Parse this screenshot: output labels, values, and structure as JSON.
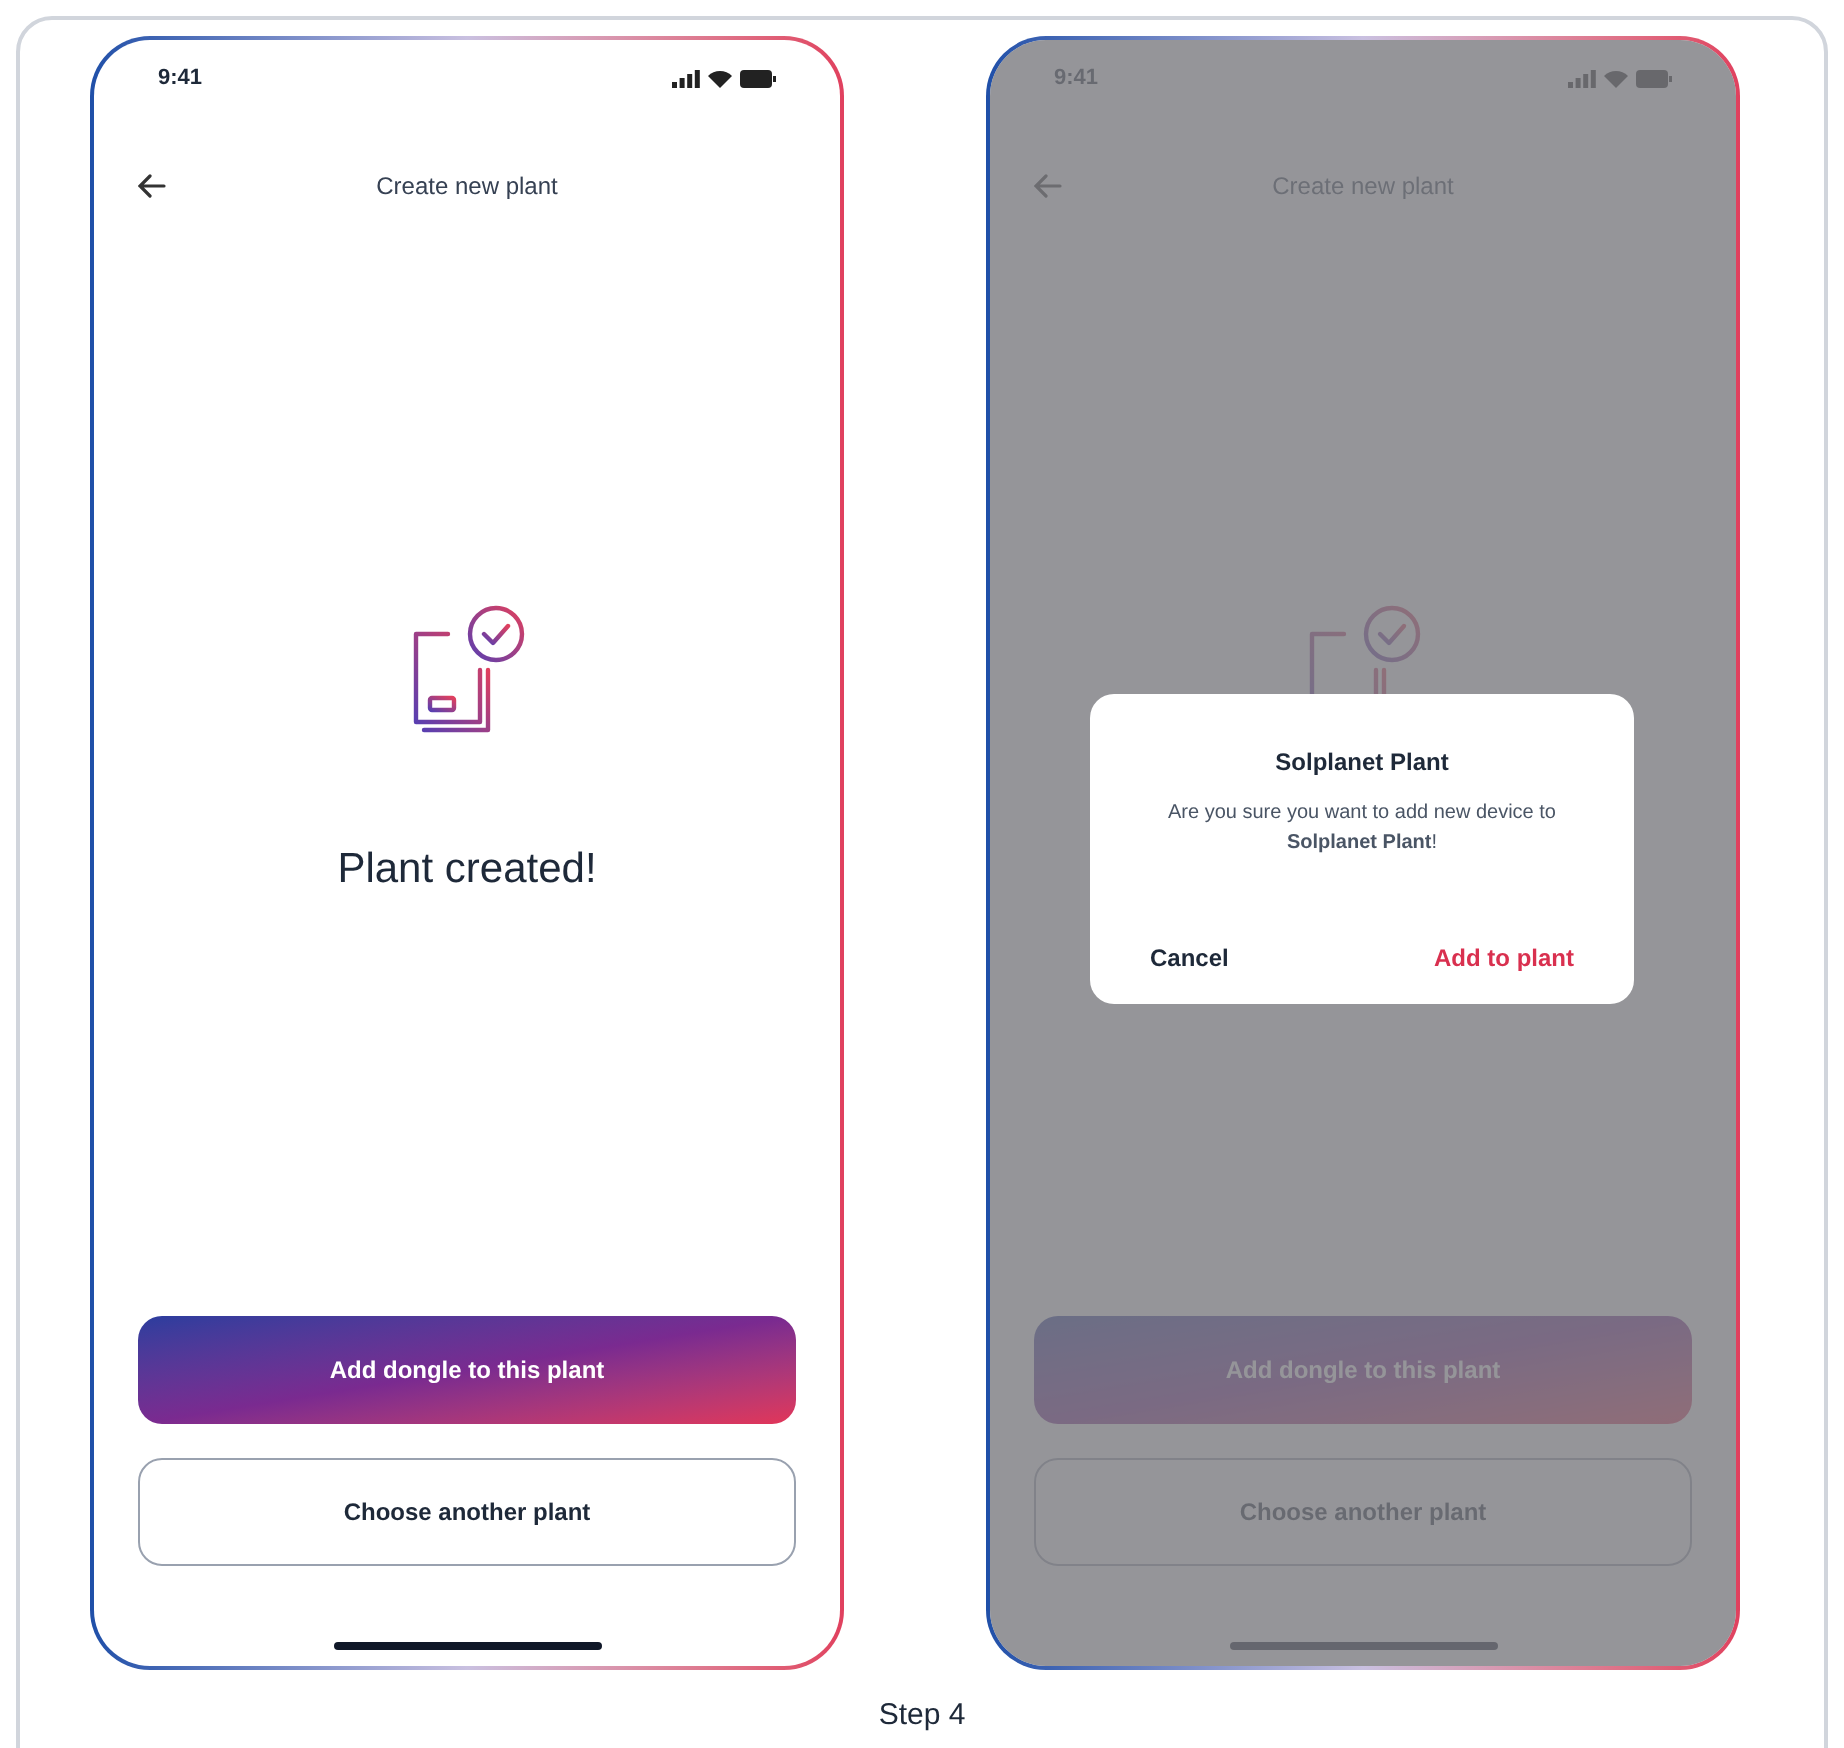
{
  "screens": [
    {
      "status_time": "9:41",
      "title": "Create new plant",
      "heading": "Plant created!",
      "dimmed": false,
      "buttons": [
        {
          "label": "Add dongle to this plant",
          "kind": "primary"
        },
        {
          "label": "Choose another plant",
          "kind": "outline"
        }
      ]
    },
    {
      "status_time": "9:41",
      "title": "Create new plant",
      "dimmed": true,
      "buttons": [
        {
          "label": "Add dongle to this plant",
          "kind": "primary"
        },
        {
          "label": "Choose another plant",
          "kind": "outline"
        }
      ],
      "dialog": {
        "title": "Solplanet Plant",
        "message": "Are you sure you want to add new device to **Solplanet Plant**!",
        "cancel": "Cancel",
        "confirm": "Add to plant"
      }
    }
  ],
  "caption": "Step 4"
}
